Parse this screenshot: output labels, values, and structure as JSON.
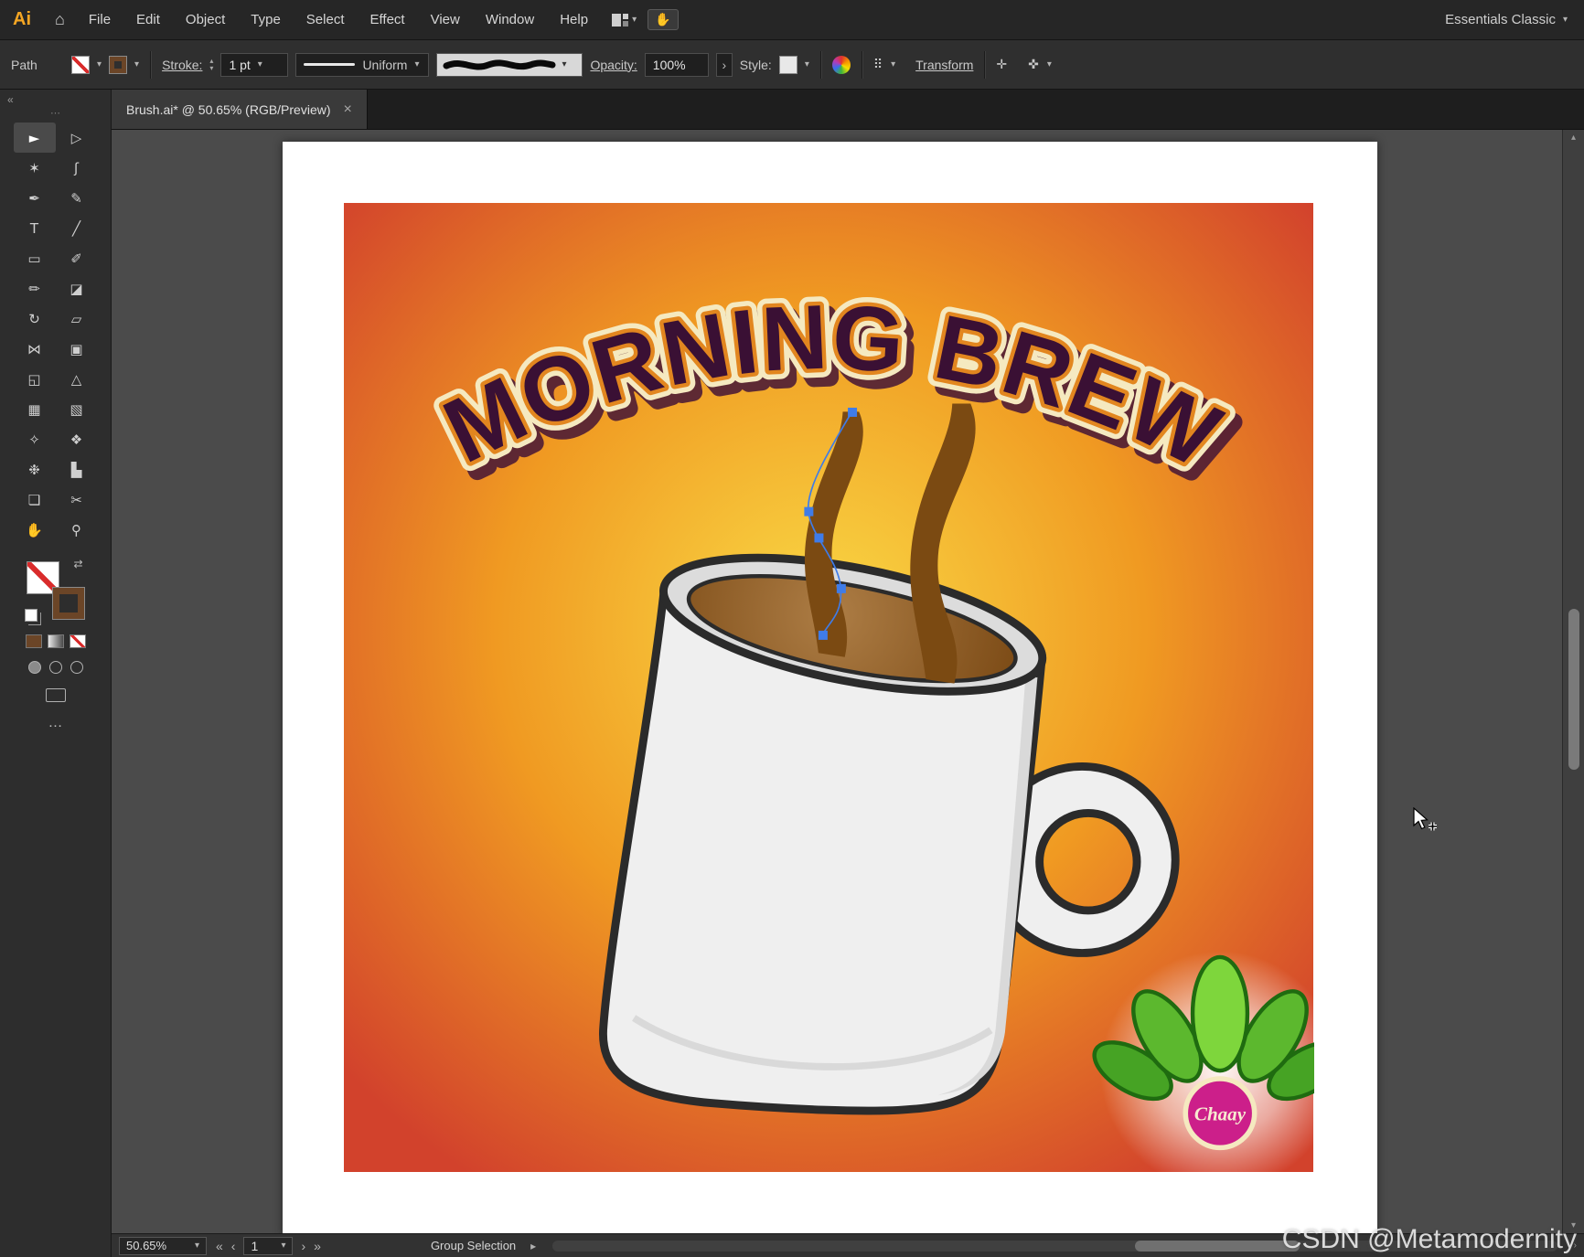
{
  "menu_bar": {
    "logo": "Ai",
    "items": [
      "File",
      "Edit",
      "Object",
      "Type",
      "Select",
      "Effect",
      "View",
      "Window",
      "Help"
    ],
    "workspace": "Essentials Classic"
  },
  "control_bar": {
    "context": "Path",
    "stroke_label": "Stroke:",
    "stroke_value": "1 pt",
    "profile": "Uniform",
    "opacity_label": "Opacity:",
    "opacity_value": "100%",
    "style_label": "Style:",
    "transform_label": "Transform"
  },
  "tab": {
    "title": "Brush.ai* @ 50.65% (RGB/Preview)"
  },
  "tools": [
    {
      "name": "selection",
      "glyph": "►"
    },
    {
      "name": "direct-selection",
      "glyph": "▷"
    },
    {
      "name": "magic-wand",
      "glyph": "✶"
    },
    {
      "name": "lasso",
      "glyph": "ʃ"
    },
    {
      "name": "pen",
      "glyph": "✒"
    },
    {
      "name": "curvature",
      "glyph": "✎"
    },
    {
      "name": "type",
      "glyph": "T"
    },
    {
      "name": "line-segment",
      "glyph": "╱"
    },
    {
      "name": "rectangle",
      "glyph": "▭"
    },
    {
      "name": "paintbrush",
      "glyph": "✐"
    },
    {
      "name": "pencil",
      "glyph": "✏"
    },
    {
      "name": "eraser",
      "glyph": "◪"
    },
    {
      "name": "rotate",
      "glyph": "↻"
    },
    {
      "name": "scale",
      "glyph": "▱"
    },
    {
      "name": "width",
      "glyph": "⋈"
    },
    {
      "name": "free-transform",
      "glyph": "▣"
    },
    {
      "name": "shape-builder",
      "glyph": "◱"
    },
    {
      "name": "perspective-grid",
      "glyph": "△"
    },
    {
      "name": "mesh",
      "glyph": "▦"
    },
    {
      "name": "gradient",
      "glyph": "▧"
    },
    {
      "name": "eyedropper",
      "glyph": "✧"
    },
    {
      "name": "blend",
      "glyph": "❖"
    },
    {
      "name": "symbol-sprayer",
      "glyph": "❉"
    },
    {
      "name": "column-graph",
      "glyph": "▙"
    },
    {
      "name": "artboard",
      "glyph": "❏"
    },
    {
      "name": "slice",
      "glyph": "✂"
    },
    {
      "name": "hand",
      "glyph": "✋"
    },
    {
      "name": "zoom",
      "glyph": "⚲"
    }
  ],
  "status_bar": {
    "zoom": "50.65%",
    "artboard_number": "1",
    "status": "Group Selection"
  },
  "artwork": {
    "title": "MORNING BREW",
    "badge_text": "Chaay",
    "colors": {
      "bg_center": "#f9d945",
      "bg_mid": "#f09a22",
      "bg_edge": "#d2422c",
      "title_fill": "#3a1034",
      "title_outline": "#f5e9c0",
      "title_accent": "#e2861f",
      "title_shadow": "#451536",
      "steam": "#7b4a12",
      "mug": "#efefef",
      "mug_outline": "#2b2b2b",
      "rim": "#dcdcdc",
      "coffee_light": "#ad7d45",
      "coffee_dark": "#7d4c17",
      "leaf_light": "#7ed63c",
      "leaf": "#5cb82e",
      "leaf_dark": "#46a324",
      "leaf_outline": "#1f6b10",
      "badge": "#cc1f8a",
      "badge_ring": "#f5e9c0",
      "selection": "#3f7ce8"
    }
  },
  "icons": {
    "chevron": "▾",
    "up": "▴",
    "down": "▾",
    "home": "⌂",
    "close": "×",
    "swap": "⇄",
    "ellipsis": "…",
    "grip": "⋯",
    "collapse": "«",
    "first": "«",
    "prev": "‹",
    "next": "›",
    "last": "»",
    "expand": "▸",
    "align_grid": "⠿",
    "align_center": "✛",
    "styles": "✜",
    "grab_hand": "✋"
  },
  "watermark": "CSDN @Metamodernity"
}
